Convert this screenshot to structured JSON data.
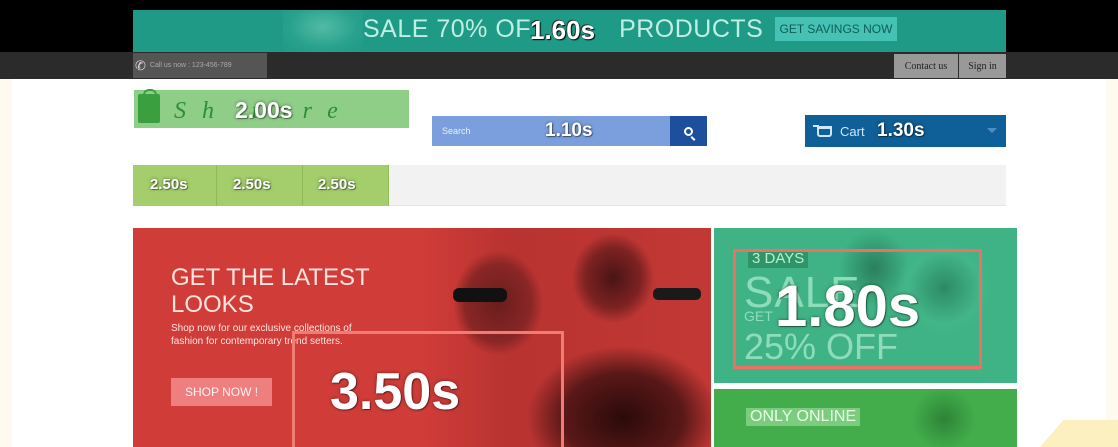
{
  "promo_banner": {
    "text": "SALE 70% OF",
    "text_tail": "PRODUCTS",
    "button_label": "GET SAVINGS NOW",
    "timing": "1.60s"
  },
  "utility_bar": {
    "call_text": "Call us now : 123-456-789",
    "contact_label": "Contact us",
    "signin_label": "Sign in"
  },
  "header": {
    "logo_letters": "Sh    tore",
    "logo_timing": "2.00s",
    "search_placeholder": "Search",
    "search_timing": "1.10s",
    "cart_label": "Cart",
    "cart_timing": "1.30s"
  },
  "nav": {
    "items": [
      {
        "timing": "2.50s"
      },
      {
        "timing": "2.50s"
      },
      {
        "timing": "2.50s"
      }
    ]
  },
  "hero": {
    "title": "GET THE LATEST LOOKS",
    "subtitle": "Shop now for our exclusive collections of fashion for contemporary trend setters.",
    "button_label": "SHOP NOW !",
    "timing": "3.50s"
  },
  "side_promo": {
    "days_tag": "3 DAYS",
    "big_text": "SALE",
    "get_text": "GET",
    "off_text": "25% OFF",
    "timing": "1.80s"
  },
  "side_promo_bottom": {
    "tag": "ONLY ONLINE"
  },
  "colors": {
    "banner_teal": "#1f9a86",
    "logo_green": "#8fce87",
    "search_blue": "#7b9fdc",
    "cart_blue": "#0f5f98",
    "nav_green": "#a3ce6b",
    "hero_red": "#d03c38",
    "highlight_box": "#ef6f66"
  }
}
